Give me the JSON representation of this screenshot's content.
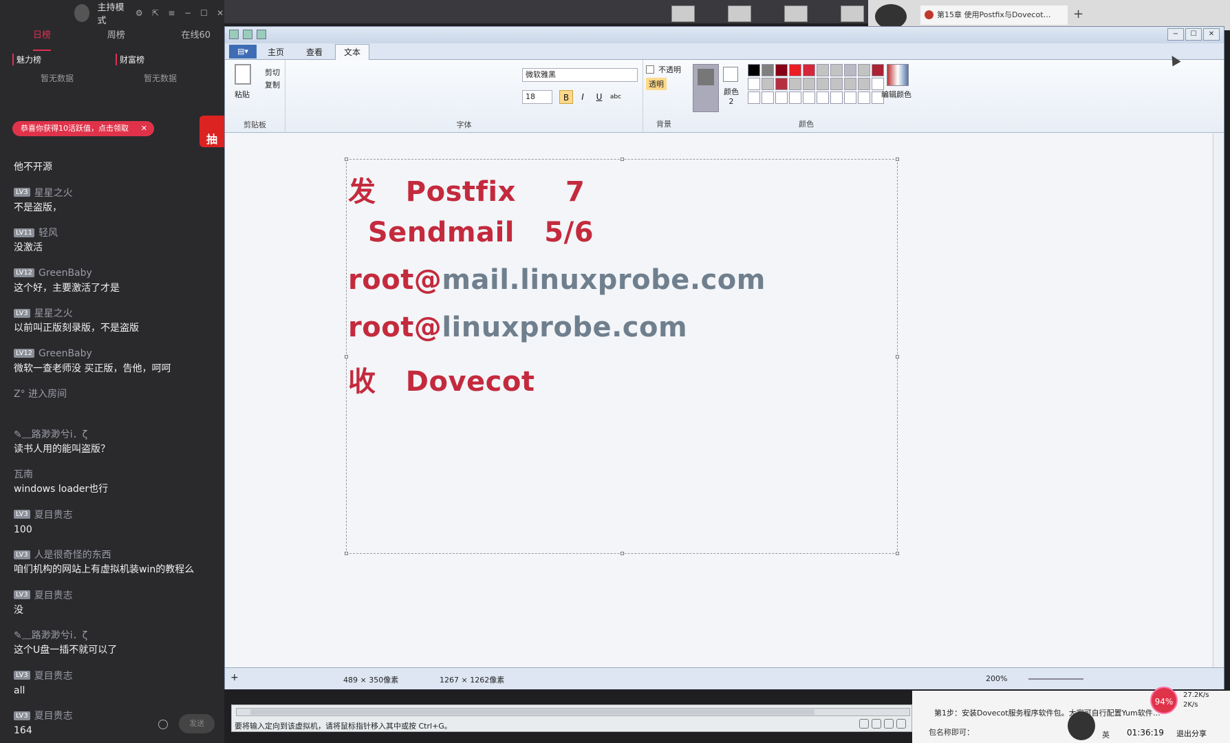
{
  "live": {
    "mode": "主持模式",
    "tabs": [
      "日榜",
      "周榜",
      "在线60"
    ],
    "ranks": [
      {
        "label": "魅力榜",
        "empty": "暂无数据"
      },
      {
        "label": "财富榜",
        "empty": "暂无数据"
      }
    ],
    "banner": "恭喜你获得10活跃值，点击领取",
    "draw": "抽",
    "messages": [
      {
        "lv": "",
        "name": "",
        "text": "他不开源"
      },
      {
        "lv": "LV3",
        "name": "星星之火",
        "text": "不是盗版，"
      },
      {
        "lv": "LV11",
        "name": "轻风",
        "text": "没激活"
      },
      {
        "lv": "LV12",
        "name": "GreenBaby",
        "text": "这个好，主要激活了才是"
      },
      {
        "lv": "LV3",
        "name": "星星之火",
        "text": "以前叫正版刻录版，不是盗版"
      },
      {
        "lv": "LV12",
        "name": "GreenBaby",
        "text": "微软一查老师没 买正版，告他，呵呵"
      },
      {
        "lv": "",
        "name": "Z° 进入房间",
        "text": ""
      },
      {
        "lv": "",
        "name": "✎﹏路渺渺兮i．ζ",
        "text": "读书人用的能叫盗版？"
      },
      {
        "lv": "",
        "name": "瓦南",
        "text": "windows loader也行"
      },
      {
        "lv": "LV3",
        "name": "夏目贵志",
        "text": "100"
      },
      {
        "lv": "LV3",
        "name": "人是很奇怪的东西",
        "text": "咱们机构的网站上有虚拟机装win的教程么"
      },
      {
        "lv": "LV3",
        "name": "夏目贵志",
        "text": "没"
      },
      {
        "lv": "",
        "name": "✎﹏路渺渺兮i．ζ",
        "text": "这个U盘一插不就可以了"
      },
      {
        "lv": "LV3",
        "name": "夏目贵志",
        "text": "all"
      },
      {
        "lv": "LV3",
        "name": "夏目贵志",
        "text": "164"
      }
    ],
    "send": "发送"
  },
  "browser": {
    "tab": "第15章 使用Postfix与Dovecot…",
    "plus": "+"
  },
  "paint": {
    "tabs": {
      "menu": "▤▾",
      "home": "主页",
      "view": "查看",
      "text": "文本"
    },
    "clipboard": {
      "paste": "粘贴",
      "cut": "剪切",
      "copy": "复制",
      "label": "剪贴板"
    },
    "font": {
      "family": "微软雅黑",
      "size": "18",
      "bold": "B",
      "italic": "I",
      "underline": "U",
      "strike": "abc",
      "label": "字体"
    },
    "background": {
      "opaque": "不透明",
      "transparent": "透明",
      "label": "背景"
    },
    "colors": {
      "color2": "颜色 2",
      "edit": "编辑颜色",
      "label": "颜色"
    },
    "palette": [
      "#000000",
      "#7f7f7f",
      "#880015",
      "#ed1c24",
      "#d6263a",
      "#c3c3c3",
      "#c3c3c3",
      "#b9b9c3",
      "#c3c3c3",
      "#aa2233",
      "#ffffff",
      "#c3c3c3",
      "#b5303f",
      "#c3c3c3",
      "#c3c3c3",
      "#c3c3c3",
      "#c3c3c3",
      "#c3c3c3",
      "#c3c3c3",
      "#ffffff",
      "#ffffff",
      "#ffffff",
      "#ffffff",
      "#ffffff",
      "#ffffff",
      "#ffffff",
      "#ffffff",
      "#ffffff",
      "#ffffff",
      "#ffffff"
    ],
    "canvas_lines": [
      {
        "parts": [
          {
            "t": "发   Postfix     7",
            "c": "red"
          }
        ]
      },
      {
        "parts": [
          {
            "t": "  Sendmail   5/6",
            "c": "red"
          }
        ]
      },
      {
        "parts": [
          {
            "t": "root@",
            "c": "red"
          },
          {
            "t": "mail.linuxprobe.com",
            "c": "gray"
          }
        ]
      },
      {
        "parts": [
          {
            "t": "root@",
            "c": "red"
          },
          {
            "t": "linuxprobe.com",
            "c": "gray"
          }
        ]
      },
      {
        "parts": [
          {
            "t": "收   Dovecot",
            "c": "red"
          }
        ]
      }
    ],
    "status": {
      "selection": "489 × 350像素",
      "size": "1267 × 1262像素",
      "zoom": "200%"
    }
  },
  "vm": {
    "message": "要将输入定向到该虚拟机，请将鼠标指针移入其中或按 Ctrl+G。"
  },
  "bottom": {
    "step": "第1步：安装Dovecot服务程序软件包。大家可自行配置Yum软件…",
    "question": "包名称即可：",
    "ime": "英",
    "time": "01:36:19",
    "exit": "退出分享",
    "badge": "94%",
    "up": "27.2K/s",
    "down": "2K/s"
  }
}
